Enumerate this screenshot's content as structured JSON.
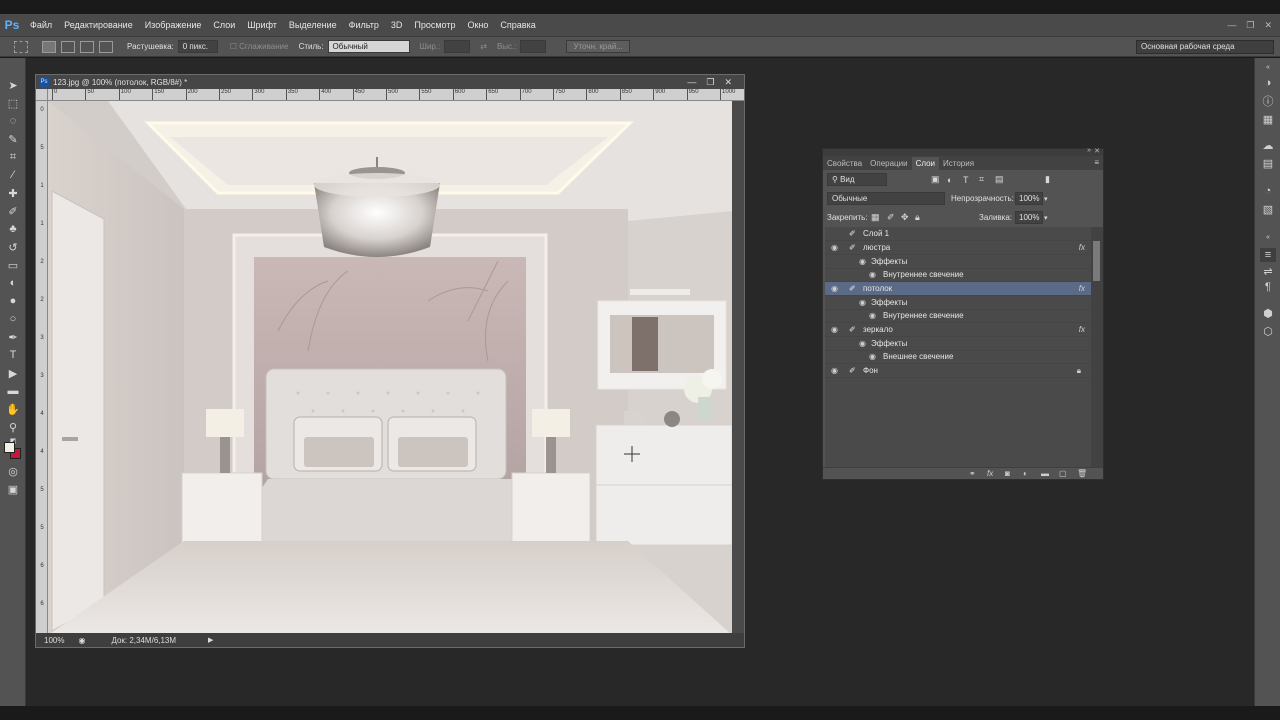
{
  "app": {
    "logo": "Ps"
  },
  "menu": [
    "Файл",
    "Редактирование",
    "Изображение",
    "Слои",
    "Шрифт",
    "Выделение",
    "Фильтр",
    "3D",
    "Просмотр",
    "Окно",
    "Справка"
  ],
  "window_controls": {
    "minimize": "—",
    "restore": "❐",
    "close": "✕"
  },
  "options": {
    "feather_label": "Растушевка:",
    "feather_value": "0 пикс.",
    "antialias_label": "Сглаживание",
    "style_label": "Стиль:",
    "style_value": "Обычный",
    "width_label": "Шир.:",
    "height_label": "Выс.:",
    "refine_button": "Уточн. край...",
    "workspace": "Основная рабочая среда"
  },
  "document": {
    "title": "123.jpg @ 100% (потолок, RGB/8#) *",
    "icon": "Ps",
    "zoom": "100%",
    "doc_info": "Док: 2,34M/6,13M",
    "ruler_h": [
      "0",
      "50",
      "100",
      "150",
      "200",
      "250",
      "300",
      "350",
      "400",
      "450",
      "500",
      "550",
      "600",
      "650",
      "700",
      "750",
      "800",
      "850",
      "900",
      "950",
      "1000"
    ],
    "ruler_v": [
      "0",
      "5",
      "1",
      "1",
      "2",
      "2",
      "3",
      "3",
      "4",
      "4",
      "5",
      "5",
      "6",
      "6"
    ]
  },
  "panel": {
    "tabs": [
      "Свойства",
      "Операции",
      "Слои",
      "История"
    ],
    "active_tab": "Слои",
    "filter_label": "Вид",
    "blend_mode": "Обычные",
    "opacity_label": "Непрозрачность:",
    "opacity_value": "100%",
    "lock_label": "Закрепить:",
    "fill_label": "Заливка:",
    "fill_value": "100%",
    "layers": [
      {
        "kind": "layer",
        "name": "Слой 1",
        "fx": "",
        "selected": false,
        "visible": false,
        "locked": false
      },
      {
        "kind": "layer",
        "name": "люстра",
        "fx": "fx",
        "selected": false,
        "visible": true,
        "locked": false
      },
      {
        "kind": "effects",
        "name": "Эффекты"
      },
      {
        "kind": "effect",
        "name": "Внутреннее свечение"
      },
      {
        "kind": "layer",
        "name": "потолок",
        "fx": "fx",
        "selected": true,
        "visible": true,
        "locked": false
      },
      {
        "kind": "effects",
        "name": "Эффекты"
      },
      {
        "kind": "effect",
        "name": "Внутреннее свечение"
      },
      {
        "kind": "layer",
        "name": "зеркало",
        "fx": "fx",
        "selected": false,
        "visible": true,
        "locked": false
      },
      {
        "kind": "effects",
        "name": "Эффекты"
      },
      {
        "kind": "effect",
        "name": "Внешнее свечение"
      },
      {
        "kind": "layer",
        "name": "Фон",
        "fx": "",
        "selected": false,
        "visible": true,
        "locked": true
      }
    ]
  },
  "colors": {
    "selection": "#5b6a86",
    "foreground": "#f3efe2",
    "background": "#c2183d"
  }
}
